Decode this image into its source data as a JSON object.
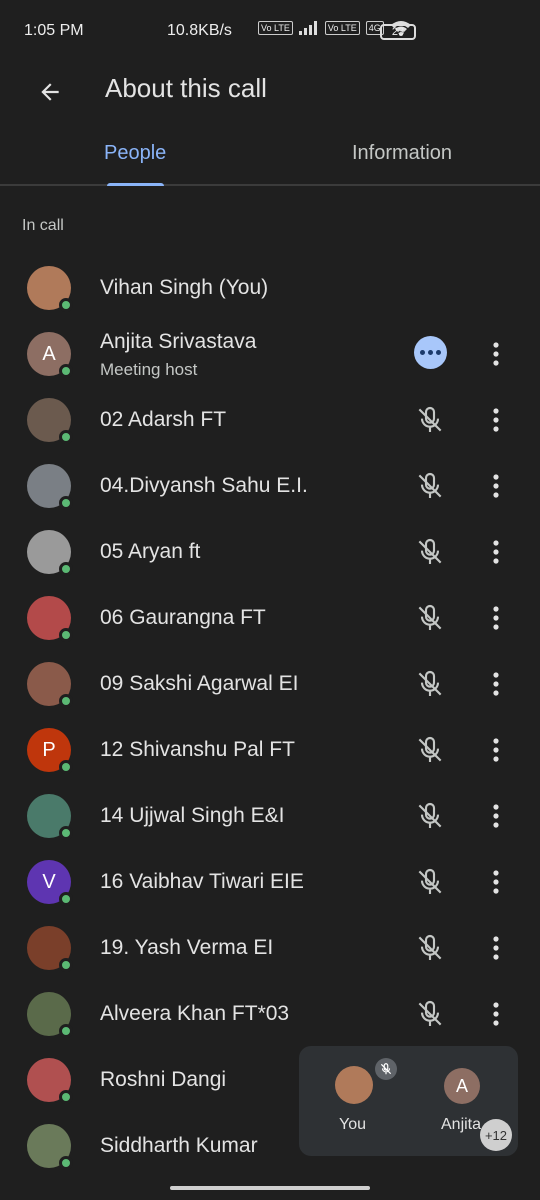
{
  "status": {
    "time": "1:05 PM",
    "speed": "10.8KB/s",
    "volte1": "Vo LTE",
    "volte2": "Vo LTE",
    "network": "4G",
    "battery": "23"
  },
  "header": {
    "title": "About this call"
  },
  "tabs": [
    {
      "label": "People"
    },
    {
      "label": "Information"
    }
  ],
  "section_label": "In call",
  "participants": [
    {
      "name": "Vihan Singh (You)",
      "initial": "",
      "avatar_color": "#b07a5a"
    },
    {
      "name": "Anjita Srivastava",
      "sub": "Meeting host",
      "initial": "A",
      "avatar_color": "#8d6e63"
    },
    {
      "name": "02 Adarsh FT",
      "initial": "",
      "avatar_color": "#6b5a4e"
    },
    {
      "name": "04.Divyansh Sahu E.I.",
      "initial": "",
      "avatar_color": "#7a7f85"
    },
    {
      "name": "05 Aryan ft",
      "initial": "",
      "avatar_color": "#9a9a9a"
    },
    {
      "name": "06 Gaurangna FT",
      "initial": "",
      "avatar_color": "#b34a4a"
    },
    {
      "name": "09 Sakshi Agarwal EI",
      "initial": "",
      "avatar_color": "#8a5a4a"
    },
    {
      "name": "12 Shivanshu Pal FT",
      "initial": "P",
      "avatar_color": "#bf360c"
    },
    {
      "name": "14 Ujjwal Singh E&I",
      "initial": "",
      "avatar_color": "#4a7a6a"
    },
    {
      "name": "16 Vaibhav Tiwari EIE",
      "initial": "V",
      "avatar_color": "#5e35b1"
    },
    {
      "name": "19. Yash Verma EI",
      "initial": "",
      "avatar_color": "#7a3f2a"
    },
    {
      "name": "Alveera Khan FT*03",
      "initial": "",
      "avatar_color": "#5a6a4a"
    },
    {
      "name": "Roshni Dangi",
      "initial": "",
      "avatar_color": "#b05050"
    },
    {
      "name": "Siddharth Kumar",
      "initial": "",
      "avatar_color": "#6a7a5a"
    }
  ],
  "pip": {
    "you_label": "You",
    "other_label": "Anjita",
    "other_initial": "A",
    "more_count": "+12"
  },
  "icons": {
    "back": "arrow-left-icon",
    "mic_off": "mic-off-icon",
    "more": "more-vert-icon",
    "speaking": "speaking-indicator-icon"
  },
  "colors": {
    "background": "#1f1f1f",
    "accent": "#8ab4f8",
    "online": "#5bb974"
  }
}
